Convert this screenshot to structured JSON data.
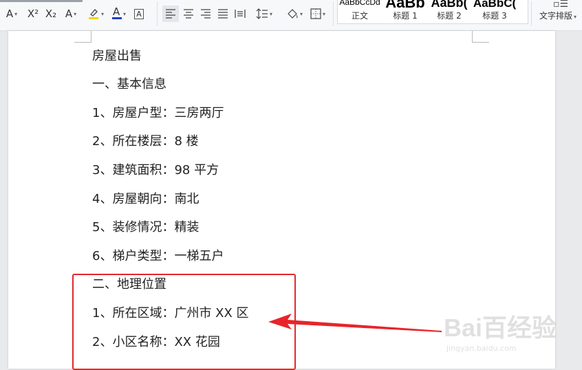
{
  "ribbon": {
    "styles": [
      {
        "preview": "AaBbCcDd",
        "label": "正文"
      },
      {
        "preview": "AaBb",
        "label": "标题 1"
      },
      {
        "preview": "AaBb(",
        "label": "标题 2"
      },
      {
        "preview": "AaBbC(",
        "label": "标题 3"
      }
    ],
    "text_layout_label": "文字排版",
    "font_tools": [
      "A",
      "X²",
      "X₂",
      "A",
      "A",
      "A"
    ]
  },
  "document": {
    "lines": [
      "房屋出售",
      "一、基本信息",
      "1、房屋户型：三房两厅",
      "2、所在楼层：8 楼",
      "3、建筑面积：98 平方",
      "4、房屋朝向：南北",
      "5、装修情况：精装",
      "6、梯户类型：一梯五户",
      "二、地理位置",
      "1、所在区域：广州市 XX 区",
      "2、小区名称：XX 花园"
    ]
  },
  "watermark": {
    "text": "Bai百经验",
    "url": "jingyan.baidu.com"
  },
  "colors": {
    "highlight": "#e0282d",
    "arrow": "#e8242a",
    "highlighter": "#f5d300",
    "font_color": "#1e3cc8"
  }
}
